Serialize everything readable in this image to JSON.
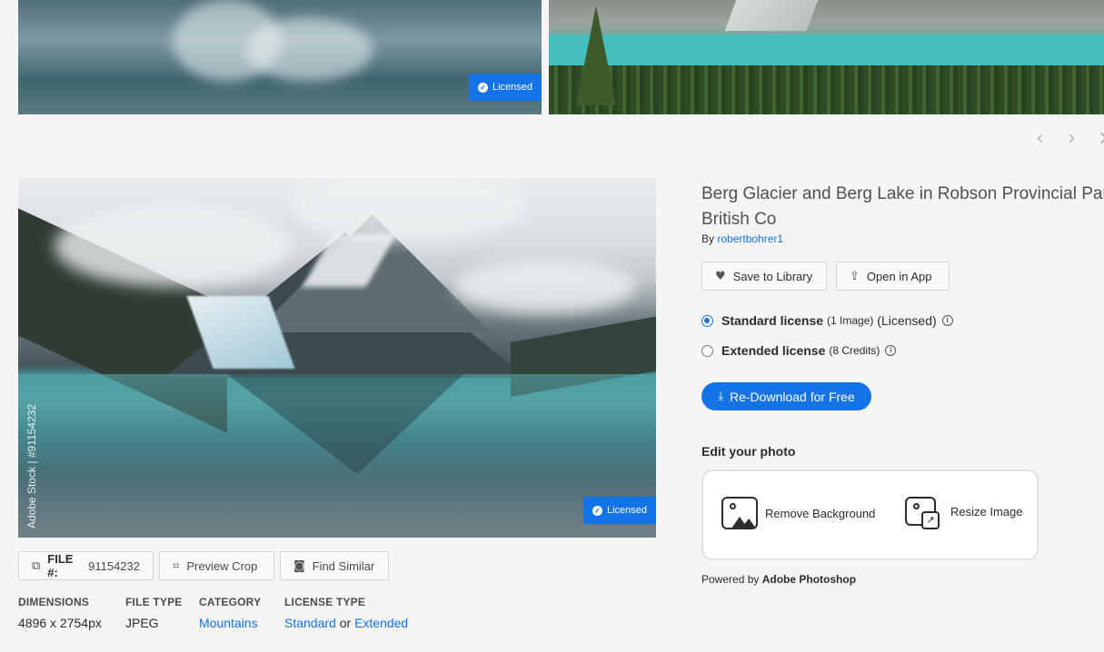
{
  "thumbnails": [
    {
      "badge": "Licensed"
    },
    {
      "badge": ""
    }
  ],
  "nav": {
    "prev_icon": "chevron-left-icon",
    "next_icon": "chevron-right-icon",
    "close_icon": "close-icon"
  },
  "photo": {
    "badge": "Licensed",
    "side_watermark": "Adobe Stock | #91154232"
  },
  "actions": {
    "file_label": "FILE #:",
    "file_number": "91154232",
    "preview_crop": "Preview Crop",
    "find_similar": "Find Similar"
  },
  "meta": {
    "dimensions_label": "DIMENSIONS",
    "dimensions_value": "4896 x 2754px",
    "filetype_label": "FILE TYPE",
    "filetype_value": "JPEG",
    "category_label": "CATEGORY",
    "category_value": "Mountains",
    "license_label": "LICENSE TYPE",
    "license_standard": "Standard",
    "license_or": "or",
    "license_extended": "Extended"
  },
  "detail": {
    "title_line1": "Berg Glacier and Berg Lake in Robson Provincial Park",
    "title_line2": "British Co",
    "by": "By",
    "author": "robertbohrer1",
    "save_to_library": "Save to Library",
    "open_in_app": "Open in App",
    "standard_license": "Standard license",
    "standard_detail": "(1 Image)",
    "standard_status": "(Licensed)",
    "extended_license": "Extended license",
    "extended_detail": "(8 Credits)",
    "cta": "Re-Download for Free",
    "edit_heading": "Edit your photo",
    "remove_background": "Remove Background",
    "resize_image": "Resize Image",
    "powered_by": "Powered by",
    "powered_app": "Adobe Photoshop"
  },
  "colors": {
    "accent": "#1473e6",
    "background": "#f5f5f5"
  }
}
